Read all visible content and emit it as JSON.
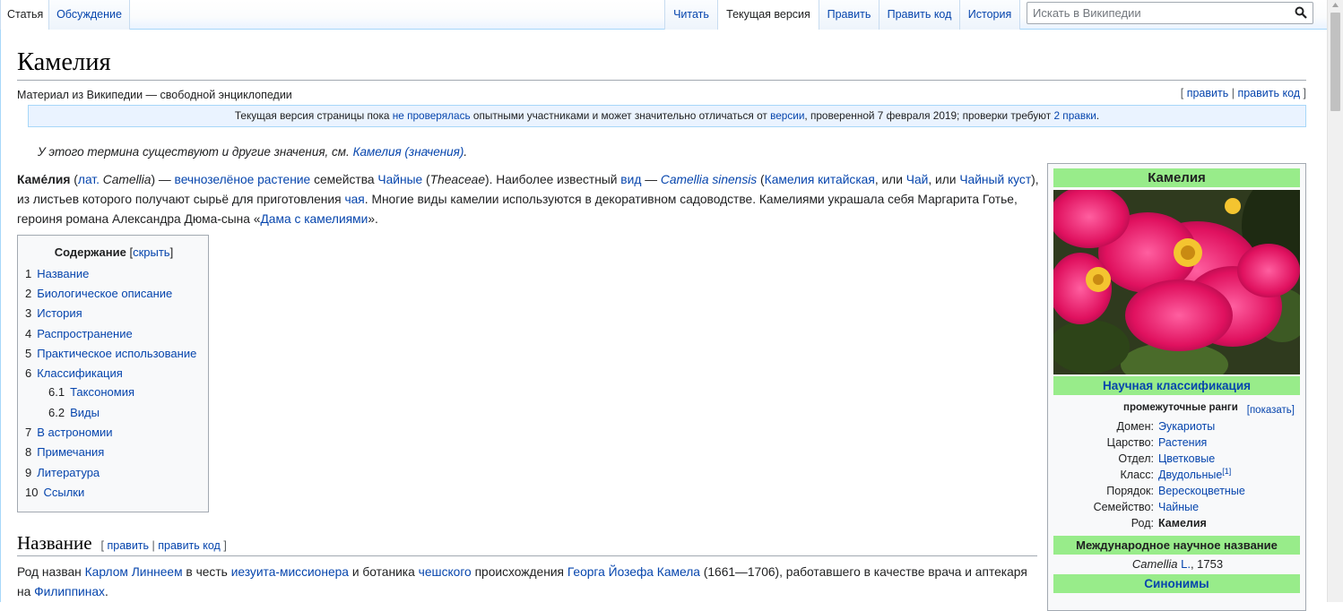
{
  "tabs": {
    "left": [
      {
        "label": "Статья",
        "selected": true
      },
      {
        "label": "Обсуждение",
        "selected": false
      }
    ],
    "right": [
      {
        "label": "Читать",
        "selected": false
      },
      {
        "label": "Текущая версия",
        "selected": true
      },
      {
        "label": "Править",
        "selected": false
      },
      {
        "label": "Править код",
        "selected": false
      },
      {
        "label": "История",
        "selected": false
      }
    ]
  },
  "search": {
    "placeholder": "Искать в Википедии",
    "icon": "search-icon"
  },
  "article": {
    "title": "Камелия",
    "tagline": "Материал из Википедии — свободной энциклопедии",
    "edit_links": {
      "open": "[ ",
      "edit": "править",
      "sep": " | ",
      "edit_code": "править код",
      "close": " ]"
    },
    "flagged": {
      "t1": "Текущая версия страницы пока ",
      "l1": "не проверялась",
      "t2": " опытными участниками и может значительно отличаться от ",
      "l2": "версии",
      "t3": ", проверенной 7 февраля 2019; проверки требуют ",
      "l3": "2 правки",
      "t4": "."
    },
    "hatnote": {
      "text": "У этого термина существуют и другие значения, см. ",
      "link": "Камелия (значения)",
      "end": "."
    },
    "lead": {
      "b": "Каме́лия",
      "t1": " (",
      "l1": "лат.",
      "t2": " ",
      "i1": "Camellia",
      "t3": ") — ",
      "l2": "вечнозелёное растение",
      "t4": " семейства ",
      "l3": "Чайные",
      "t5": " (",
      "i2": "Theaceae",
      "t6": "). Наиболее известный ",
      "l4": "вид",
      "t7": " — ",
      "l5": "Camellia sinensis",
      "t8": " (",
      "l6": "Камелия китайская",
      "t9": ", или ",
      "l7": "Чай",
      "t10": ", или ",
      "l8": "Чайный куст",
      "t11": "), из листьев которого получают сырьё для приготовления ",
      "l9": "чая",
      "t12": ". Многие виды камелии используются в декоративном садоводстве. Камелиями украшала себя Маргарита Готье, героиня романа Александра Дюма-сына «",
      "l10": "Дама с камелиями",
      "t13": "»."
    },
    "toc": {
      "title": "Содержание",
      "toggle_open": " [",
      "toggle": "скрыть",
      "toggle_close": "]",
      "items": [
        {
          "num": "1",
          "label": "Название"
        },
        {
          "num": "2",
          "label": "Биологическое описание"
        },
        {
          "num": "3",
          "label": "История"
        },
        {
          "num": "4",
          "label": "Распространение"
        },
        {
          "num": "5",
          "label": "Практическое использование"
        },
        {
          "num": "6",
          "label": "Классификация"
        },
        {
          "num": "6.1",
          "label": "Таксономия"
        },
        {
          "num": "6.2",
          "label": "Виды"
        },
        {
          "num": "7",
          "label": "В астрономии"
        },
        {
          "num": "8",
          "label": "Примечания"
        },
        {
          "num": "9",
          "label": "Литература"
        },
        {
          "num": "10",
          "label": "Ссылки"
        }
      ]
    },
    "section1": {
      "heading": "Название",
      "para": {
        "t1": "Род назван ",
        "l1": "Карлом Линнеем",
        "t2": " в честь ",
        "l2": "иезуита-миссионера",
        "t3": " и ботаника ",
        "l3": "чешского",
        "t4": " происхождения ",
        "l4": "Георга Йозефа Камела",
        "t5": " (1661—1706), работавшего в качестве врача и аптекаря на ",
        "l5": "Филиппинах",
        "t6": "."
      }
    }
  },
  "infobox": {
    "title": "Камелия",
    "classification_header": "Научная классификация",
    "ranks_label": "промежуточные ранги",
    "show": "[показать]",
    "rows": [
      {
        "label": "Домен:",
        "value": "Эукариоты",
        "bold": false,
        "sup": ""
      },
      {
        "label": "Царство:",
        "value": "Растения",
        "bold": false,
        "sup": ""
      },
      {
        "label": "Отдел:",
        "value": "Цветковые",
        "bold": false,
        "sup": ""
      },
      {
        "label": "Класс:",
        "value": "Двудольные",
        "bold": false,
        "sup": "[1]"
      },
      {
        "label": "Порядок:",
        "value": "Верескоцветные",
        "bold": false,
        "sup": ""
      },
      {
        "label": "Семейство:",
        "value": "Чайные",
        "bold": false,
        "sup": ""
      },
      {
        "label": "Род:",
        "value": "Камелия",
        "bold": true,
        "sup": ""
      }
    ],
    "intl_header": "Международное научное название",
    "latin": {
      "name": "Camellia",
      "author": "L.",
      "year": ", 1753"
    },
    "synonyms_header": "Синонимы"
  },
  "colors": {
    "link": "#0645ad",
    "infobox_band": "#98ec8a",
    "border": "#a2a9b1",
    "notice_bg": "#eaf3ff"
  }
}
